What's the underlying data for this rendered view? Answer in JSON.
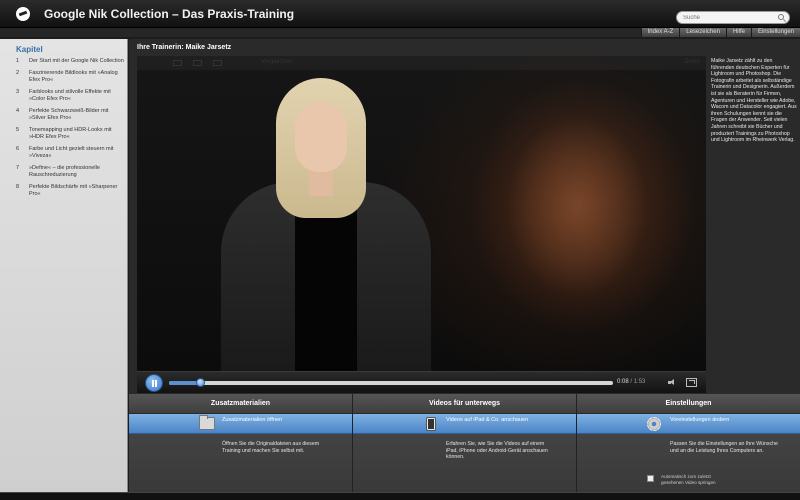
{
  "app": {
    "title": "Google Nik Collection – Das Praxis-Training",
    "logo_icon": "logo-icon"
  },
  "search": {
    "placeholder": "Suche",
    "icon": "search-icon"
  },
  "nav": {
    "tabs": [
      "Index A-Z",
      "Lesezeichen",
      "Hilfe",
      "Einstellungen"
    ]
  },
  "sidebar": {
    "title": "Kapitel",
    "chapters": [
      {
        "num": "1",
        "label": "Der Start mit der Google Nik Collection"
      },
      {
        "num": "2",
        "label": "Faszinierende Bildlooks mit »Analog Efex Pro«"
      },
      {
        "num": "3",
        "label": "Farblooks und stilvolle Effekte mit »Color Efex Pro«"
      },
      {
        "num": "4",
        "label": "Perfekte Schwarzweiß-Bilder mit »Silver Efex Pro«"
      },
      {
        "num": "5",
        "label": "Tonemapping und HDR-Looks mit »HDR Efex Pro«"
      },
      {
        "num": "6",
        "label": "Farbe und Licht gezielt steuern mit »Viveza«"
      },
      {
        "num": "7",
        "label": "»Define« – die professionelle Rauschreduzierung"
      },
      {
        "num": "8",
        "label": "Perfekte Bildschärfe mit »Sharpener Pro«"
      }
    ]
  },
  "main": {
    "header": "Ihre Trainerin: Maike Jarsetz",
    "video_toolbar_label": "Vergleichen",
    "video_toolbar_zoom": "Zoom"
  },
  "player": {
    "current_time": "0:08",
    "total_time": "/ 1:53",
    "progress": 0.07,
    "icons": [
      "pause-icon",
      "volume-icon",
      "fullscreen-icon"
    ]
  },
  "bio": "Maike Jarsetz zählt zu den führenden deutschen Experten für Lightroom und Photoshop. Die Fotografin arbeitet als selbständige Trainerin und Designerin. Außerdem ist sie als Beraterin für Firmen, Agenturen und Hersteller wie Adobe, Wacom und Datacolor engagiert. Aus ihren Schulungen kennt sie die Fragen der Anwender. Seit vielen Jahren schreibt sie Bücher und produziert Trainings zu Photoshop und Lightroom im Rheinwerk Verlag.",
  "panels": [
    {
      "title": "Zusatzmaterialien",
      "action": "Zusatzmaterialien öffnen",
      "icon": "folder-icon",
      "desc": "Öffnen Sie die Originaldateien aus diesem Training und machen Sie selbst mit."
    },
    {
      "title": "Videos für unterwegs",
      "action": "Videos auf iPad & Co. anschauen",
      "icon": "tablet-icon",
      "desc": "Erfahren Sie, wie Sie die Videos auf einem iPad, iPhone oder Android-Gerät anschauen können."
    },
    {
      "title": "Einstellungen",
      "action": "Voreinstellungen ändern",
      "icon": "gear-icon",
      "desc": "Passen Sie die Einstellungen an Ihre Wünsche und an die Leistung Ihres Computers an.",
      "checkbox_label": "Automatisch zum zuletzt gesehenen Video springen",
      "checkbox_checked": false
    }
  ],
  "colors": {
    "accent": "#4b84c6",
    "sidebar_title": "#3a6ea5"
  }
}
